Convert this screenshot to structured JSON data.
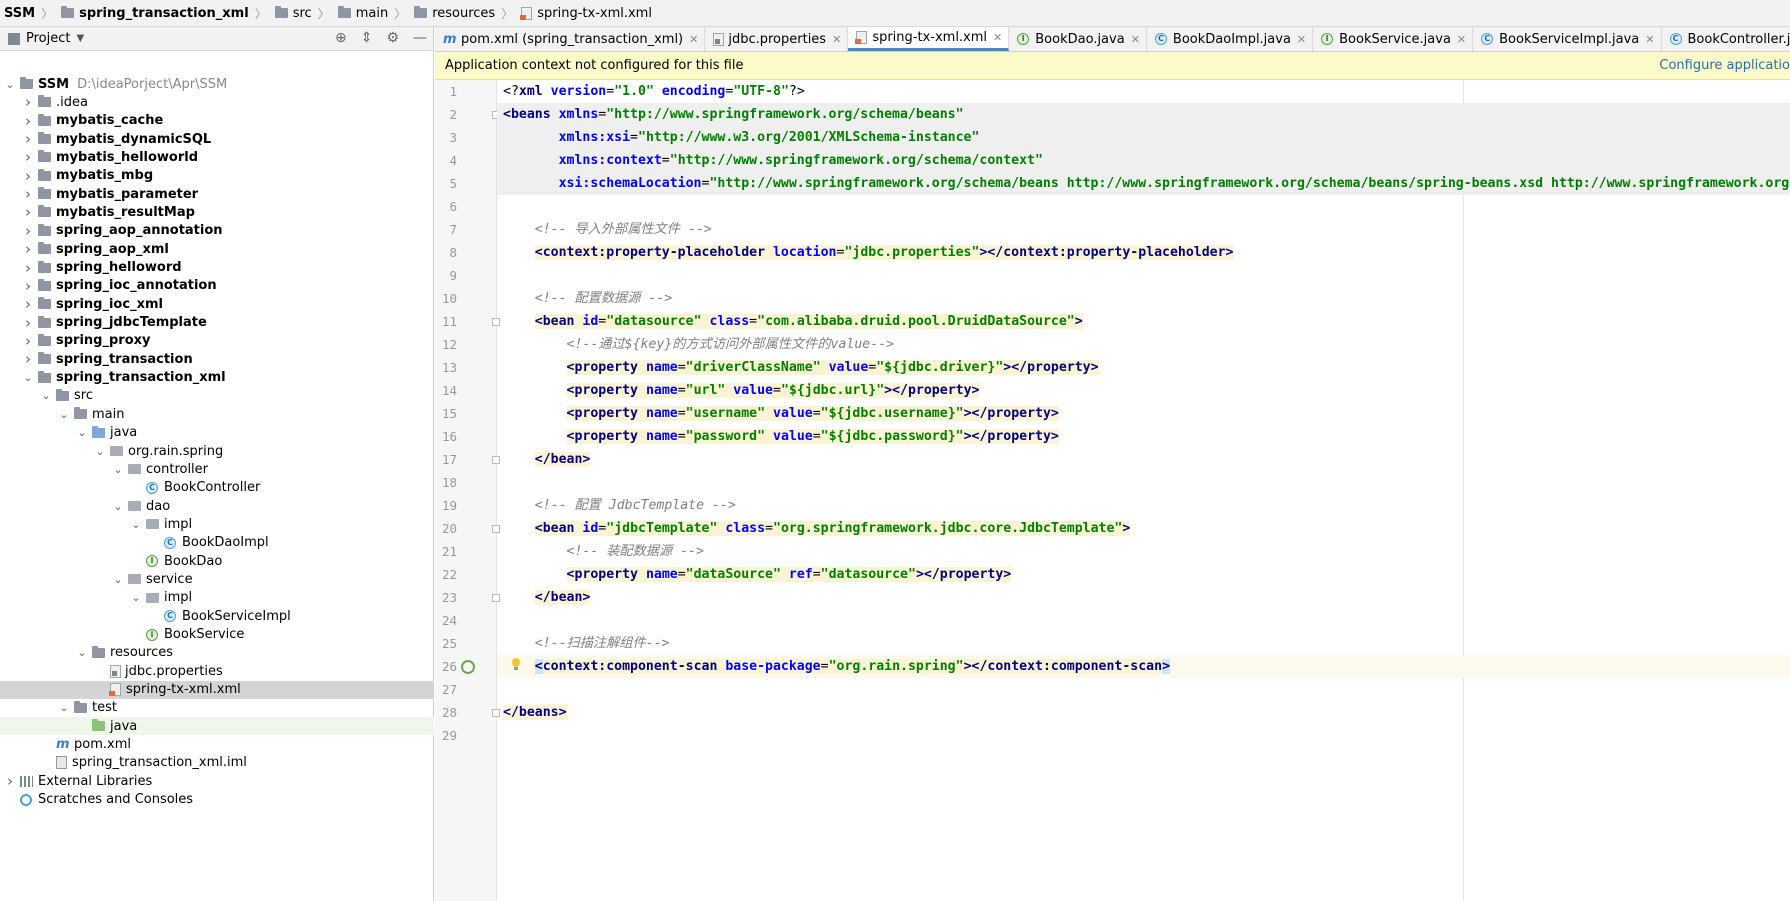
{
  "breadcrumb": [
    "SSM",
    "spring_transaction_xml",
    "src",
    "main",
    "resources",
    "spring-tx-xml.xml"
  ],
  "project_panel": {
    "title": "Project",
    "tree": [
      {
        "label": "SSM",
        "path": "D:\\ideaPorject\\Apr\\SSM",
        "indent": 0,
        "arrow": "open",
        "icon": "folder",
        "bold": true
      },
      {
        "label": ".idea",
        "indent": 1,
        "arrow": "closed",
        "icon": "folder"
      },
      {
        "label": "mybatis_cache",
        "indent": 1,
        "arrow": "closed",
        "icon": "module",
        "bold": true
      },
      {
        "label": "mybatis_dynamicSQL",
        "indent": 1,
        "arrow": "closed",
        "icon": "module",
        "bold": true
      },
      {
        "label": "mybatis_helloworld",
        "indent": 1,
        "arrow": "closed",
        "icon": "module",
        "bold": true
      },
      {
        "label": "mybatis_mbg",
        "indent": 1,
        "arrow": "closed",
        "icon": "module",
        "bold": true
      },
      {
        "label": "mybatis_parameter",
        "indent": 1,
        "arrow": "closed",
        "icon": "module",
        "bold": true
      },
      {
        "label": "mybatis_resultMap",
        "indent": 1,
        "arrow": "closed",
        "icon": "module",
        "bold": true
      },
      {
        "label": "spring_aop_annotation",
        "indent": 1,
        "arrow": "closed",
        "icon": "module",
        "bold": true
      },
      {
        "label": "spring_aop_xml",
        "indent": 1,
        "arrow": "closed",
        "icon": "module",
        "bold": true
      },
      {
        "label": "spring_helloword",
        "indent": 1,
        "arrow": "closed",
        "icon": "module",
        "bold": true
      },
      {
        "label": "spring_ioc_annotation",
        "indent": 1,
        "arrow": "closed",
        "icon": "module",
        "bold": true
      },
      {
        "label": "spring_ioc_xml",
        "indent": 1,
        "arrow": "closed",
        "icon": "module",
        "bold": true
      },
      {
        "label": "spring_jdbcTemplate",
        "indent": 1,
        "arrow": "closed",
        "icon": "module",
        "bold": true
      },
      {
        "label": "spring_proxy",
        "indent": 1,
        "arrow": "closed",
        "icon": "module",
        "bold": true
      },
      {
        "label": "spring_transaction",
        "indent": 1,
        "arrow": "closed",
        "icon": "module",
        "bold": true
      },
      {
        "label": "spring_transaction_xml",
        "indent": 1,
        "arrow": "open",
        "icon": "module",
        "bold": true
      },
      {
        "label": "src",
        "indent": 2,
        "arrow": "open",
        "icon": "folder"
      },
      {
        "label": "main",
        "indent": 3,
        "arrow": "open",
        "icon": "folder"
      },
      {
        "label": "java",
        "indent": 4,
        "arrow": "open",
        "icon": "folder-blue"
      },
      {
        "label": "org.rain.spring",
        "indent": 5,
        "arrow": "open",
        "icon": "package"
      },
      {
        "label": "controller",
        "indent": 6,
        "arrow": "open",
        "icon": "package"
      },
      {
        "label": "BookController",
        "indent": 7,
        "arrow": "none",
        "icon": "class"
      },
      {
        "label": "dao",
        "indent": 6,
        "arrow": "open",
        "icon": "package"
      },
      {
        "label": "impl",
        "indent": 7,
        "arrow": "open",
        "icon": "package"
      },
      {
        "label": "BookDaoImpl",
        "indent": 8,
        "arrow": "none",
        "icon": "class"
      },
      {
        "label": "BookDao",
        "indent": 7,
        "arrow": "none",
        "icon": "interface"
      },
      {
        "label": "service",
        "indent": 6,
        "arrow": "open",
        "icon": "package"
      },
      {
        "label": "impl",
        "indent": 7,
        "arrow": "open",
        "icon": "package"
      },
      {
        "label": "BookServiceImpl",
        "indent": 8,
        "arrow": "none",
        "icon": "class"
      },
      {
        "label": "BookService",
        "indent": 7,
        "arrow": "none",
        "icon": "interface"
      },
      {
        "label": "resources",
        "indent": 4,
        "arrow": "open",
        "icon": "folder-res"
      },
      {
        "label": "jdbc.properties",
        "indent": 5,
        "arrow": "none",
        "icon": "properties"
      },
      {
        "label": "spring-tx-xml.xml",
        "indent": 5,
        "arrow": "none",
        "icon": "xml",
        "selected": true
      },
      {
        "label": "test",
        "indent": 3,
        "arrow": "open",
        "icon": "folder"
      },
      {
        "label": "java",
        "indent": 4,
        "arrow": "none",
        "icon": "folder-green",
        "green": true
      },
      {
        "label": "pom.xml",
        "indent": 2,
        "arrow": "none",
        "icon": "maven"
      },
      {
        "label": "spring_transaction_xml.iml",
        "indent": 2,
        "arrow": "none",
        "icon": "iml"
      },
      {
        "label": "External Libraries",
        "indent": 0,
        "arrow": "closed",
        "icon": "library"
      },
      {
        "label": "Scratches and Consoles",
        "indent": 0,
        "arrow": "none",
        "icon": "scratches"
      }
    ]
  },
  "tabs": [
    {
      "label": "pom.xml (spring_transaction_xml)",
      "icon": "maven"
    },
    {
      "label": "jdbc.properties",
      "icon": "properties"
    },
    {
      "label": "spring-tx-xml.xml",
      "icon": "xml",
      "active": true
    },
    {
      "label": "BookDao.java",
      "icon": "interface"
    },
    {
      "label": "BookDaoImpl.java",
      "icon": "class"
    },
    {
      "label": "BookService.java",
      "icon": "interface"
    },
    {
      "label": "BookServiceImpl.java",
      "icon": "class"
    },
    {
      "label": "BookController.java",
      "icon": "class"
    }
  ],
  "notice": {
    "text": "Application context not configured for this file",
    "action": "Configure applicatio"
  },
  "editor": {
    "lines": [
      {
        "n": "1",
        "segs": [
          [
            "p",
            "<?"
          ],
          [
            "t",
            "xml "
          ],
          [
            "a",
            "version"
          ],
          [
            "p",
            "="
          ],
          [
            "s",
            "\"1.0\" "
          ],
          [
            "a",
            "encoding"
          ],
          [
            "p",
            "="
          ],
          [
            "s",
            "\"UTF-8\""
          ],
          [
            "p",
            "?>"
          ]
        ]
      },
      {
        "n": "2",
        "bg": "#efefef",
        "segs": [
          [
            "t",
            "<beans "
          ],
          [
            "a",
            "xmlns"
          ],
          [
            "p",
            "="
          ],
          [
            "s",
            "\"http://www.springframework.org/schema/beans\""
          ]
        ]
      },
      {
        "n": "3",
        "bg": "#efefef",
        "segs": [
          [
            "p",
            "       "
          ],
          [
            "a",
            "xmlns:xsi"
          ],
          [
            "p",
            "="
          ],
          [
            "s",
            "\"http://www.w3.org/2001/XMLSchema-instance\""
          ]
        ]
      },
      {
        "n": "4",
        "bg": "#efefef",
        "segs": [
          [
            "p",
            "       "
          ],
          [
            "a",
            "xmlns:context"
          ],
          [
            "p",
            "="
          ],
          [
            "s",
            "\"http://www.springframework.org/schema/context\""
          ]
        ]
      },
      {
        "n": "5",
        "bg": "#efefef",
        "segs": [
          [
            "p",
            "       "
          ],
          [
            "a",
            "xsi:schemaLocation"
          ],
          [
            "p",
            "="
          ],
          [
            "s",
            "\"http://www.springframework.org/schema/beans http://www.springframework.org/schema/beans/spring-beans.xsd http://www.springframework.org/sc"
          ]
        ]
      },
      {
        "n": "6",
        "segs": []
      },
      {
        "n": "7",
        "segs": [
          [
            "p",
            "    "
          ],
          [
            "c",
            "<!-- 导入外部属性文件 -->"
          ]
        ]
      },
      {
        "n": "8",
        "segs": [
          [
            "p",
            "    "
          ],
          [
            "t",
            "<context:property-placeholder ",
            "tagbg"
          ],
          [
            "a",
            "location",
            "tagbg"
          ],
          [
            "p",
            "=",
            "tagbg"
          ],
          [
            "s",
            "\"jdbc.properties\"",
            "tagbg"
          ],
          [
            "t",
            "></context:property-placeholder>",
            "tagbg"
          ]
        ]
      },
      {
        "n": "9",
        "segs": []
      },
      {
        "n": "10",
        "segs": [
          [
            "p",
            "    "
          ],
          [
            "c",
            "<!-- 配置数据源 -->"
          ]
        ]
      },
      {
        "n": "11",
        "segs": [
          [
            "p",
            "    "
          ],
          [
            "t",
            "<bean ",
            "tagbg"
          ],
          [
            "a",
            "id",
            "tagbg"
          ],
          [
            "p",
            "=",
            "tagbg"
          ],
          [
            "s",
            "\"datasource\" ",
            "tagbg"
          ],
          [
            "a",
            "class",
            "tagbg"
          ],
          [
            "p",
            "=",
            "tagbg"
          ],
          [
            "s",
            "\"com.alibaba.druid.pool.DruidDataSource\"",
            "tagbg"
          ],
          [
            "t",
            ">",
            "tagbg"
          ]
        ]
      },
      {
        "n": "12",
        "segs": [
          [
            "p",
            "        "
          ],
          [
            "c",
            "<!--通过${key}的方式访问外部属性文件的value-->"
          ]
        ]
      },
      {
        "n": "13",
        "segs": [
          [
            "p",
            "        "
          ],
          [
            "t",
            "<property ",
            "tagbg"
          ],
          [
            "a",
            "name",
            "tagbg"
          ],
          [
            "p",
            "=",
            "tagbg"
          ],
          [
            "s",
            "\"driverClassName\" ",
            "tagbg"
          ],
          [
            "a",
            "value",
            "tagbg"
          ],
          [
            "p",
            "=",
            "tagbg"
          ],
          [
            "s",
            "\"${jdbc.driver}\"",
            "tagbg"
          ],
          [
            "t",
            "></property>",
            "tagbg"
          ]
        ]
      },
      {
        "n": "14",
        "segs": [
          [
            "p",
            "        "
          ],
          [
            "t",
            "<property ",
            "tagbg"
          ],
          [
            "a",
            "name",
            "tagbg"
          ],
          [
            "p",
            "=",
            "tagbg"
          ],
          [
            "s",
            "\"url\" ",
            "tagbg"
          ],
          [
            "a",
            "value",
            "tagbg"
          ],
          [
            "p",
            "=",
            "tagbg"
          ],
          [
            "s",
            "\"${jdbc.url}\"",
            "tagbg"
          ],
          [
            "t",
            "></property>",
            "tagbg"
          ]
        ]
      },
      {
        "n": "15",
        "segs": [
          [
            "p",
            "        "
          ],
          [
            "t",
            "<property ",
            "tagbg"
          ],
          [
            "a",
            "name",
            "tagbg"
          ],
          [
            "p",
            "=",
            "tagbg"
          ],
          [
            "s",
            "\"username\" ",
            "tagbg"
          ],
          [
            "a",
            "value",
            "tagbg"
          ],
          [
            "p",
            "=",
            "tagbg"
          ],
          [
            "s",
            "\"${jdbc.username}\"",
            "tagbg"
          ],
          [
            "t",
            "></property>",
            "tagbg"
          ]
        ]
      },
      {
        "n": "16",
        "segs": [
          [
            "p",
            "        "
          ],
          [
            "t",
            "<property ",
            "tagbg"
          ],
          [
            "a",
            "name",
            "tagbg"
          ],
          [
            "p",
            "=",
            "tagbg"
          ],
          [
            "s",
            "\"password\" ",
            "tagbg"
          ],
          [
            "a",
            "value",
            "tagbg"
          ],
          [
            "p",
            "=",
            "tagbg"
          ],
          [
            "s",
            "\"${jdbc.password}\"",
            "tagbg"
          ],
          [
            "t",
            "></property>",
            "tagbg"
          ]
        ]
      },
      {
        "n": "17",
        "segs": [
          [
            "p",
            "    "
          ],
          [
            "t",
            "</bean>",
            "tagbg"
          ]
        ]
      },
      {
        "n": "18",
        "segs": []
      },
      {
        "n": "19",
        "segs": [
          [
            "p",
            "    "
          ],
          [
            "c",
            "<!-- 配置 JdbcTemplate -->"
          ]
        ]
      },
      {
        "n": "20",
        "segs": [
          [
            "p",
            "    "
          ],
          [
            "t",
            "<bean ",
            "tagbg"
          ],
          [
            "a",
            "id",
            "tagbg"
          ],
          [
            "p",
            "=",
            "tagbg"
          ],
          [
            "s",
            "\"jdbcTemplate\" ",
            "tagbg"
          ],
          [
            "a",
            "class",
            "tagbg"
          ],
          [
            "p",
            "=",
            "tagbg"
          ],
          [
            "s",
            "\"org.springframework.jdbc.core.JdbcTemplate\"",
            "tagbg"
          ],
          [
            "t",
            ">",
            "tagbg"
          ]
        ]
      },
      {
        "n": "21",
        "segs": [
          [
            "p",
            "        "
          ],
          [
            "c",
            "<!-- 装配数据源 -->"
          ]
        ]
      },
      {
        "n": "22",
        "segs": [
          [
            "p",
            "        "
          ],
          [
            "t",
            "<property ",
            "tagbg"
          ],
          [
            "a",
            "name",
            "tagbg"
          ],
          [
            "p",
            "=",
            "tagbg"
          ],
          [
            "s",
            "\"dataSource\" ",
            "tagbg"
          ],
          [
            "a",
            "ref",
            "tagbg"
          ],
          [
            "p",
            "=",
            "tagbg"
          ],
          [
            "s",
            "\"datasource\"",
            "tagbg"
          ],
          [
            "t",
            "></property>",
            "tagbg"
          ]
        ]
      },
      {
        "n": "23",
        "segs": [
          [
            "p",
            "    "
          ],
          [
            "t",
            "</bean>",
            "tagbg"
          ]
        ]
      },
      {
        "n": "24",
        "segs": []
      },
      {
        "n": "25",
        "segs": [
          [
            "p",
            "    "
          ],
          [
            "c",
            "<!--扫描注解组件-->"
          ]
        ]
      },
      {
        "n": "26",
        "bg": "#fcfaed",
        "segs": [
          [
            "p",
            "    "
          ],
          [
            "t",
            "<",
            "cursor"
          ],
          [
            "t",
            "context:component-scan ",
            "tagbg"
          ],
          [
            "a",
            "base-package",
            "tagbg"
          ],
          [
            "p",
            "=",
            "tagbg"
          ],
          [
            "s",
            "\"org.rain.spring\"",
            "tagbg"
          ],
          [
            "t",
            "></context:component-scan",
            "tagbg"
          ],
          [
            "t",
            ">",
            "cursor"
          ]
        ]
      },
      {
        "n": "27",
        "segs": []
      },
      {
        "n": "28",
        "segs": [
          [
            "t",
            "</beans>",
            "tagbg"
          ]
        ]
      },
      {
        "n": "29",
        "segs": []
      }
    ]
  }
}
